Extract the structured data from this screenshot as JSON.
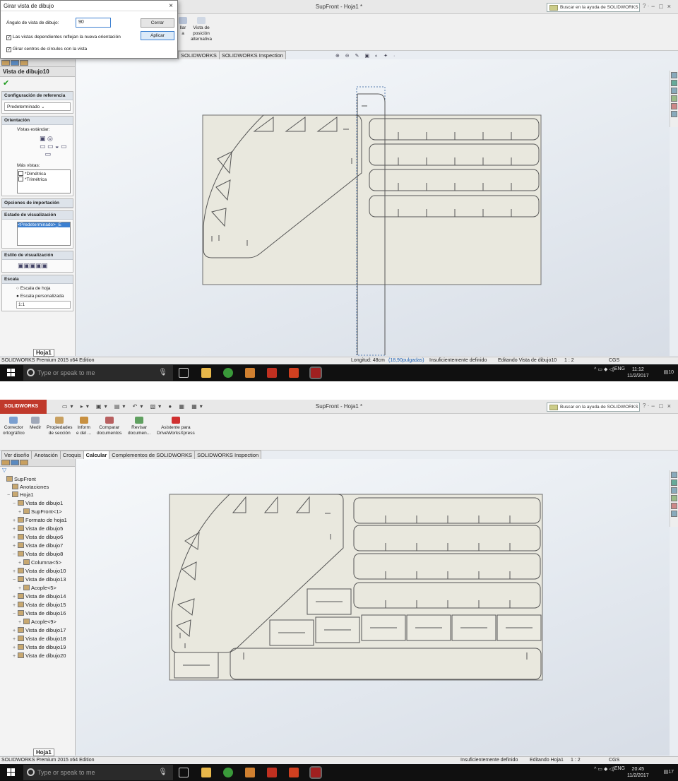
{
  "shot1": {
    "window_title": "SupFront - Hoja1 *",
    "search_placeholder": "Buscar en la ayuda de SOLIDWORKS",
    "ribbon_items": [
      "llar\na",
      "Vista de\nposición\nalternativa"
    ],
    "tabs": [
      "SOLIDWORKS",
      "SOLIDWORKS Inspection"
    ],
    "dialog": {
      "title": "Girar vista de dibujo",
      "angle_label": "Ángulo de vista de dibujo:",
      "angle_value": "90",
      "close_button": "Cerrar",
      "apply_button": "Aplicar",
      "check_dependent": "Las vistas dependientes reflejan la nueva orientación",
      "check_circles": "Girar centros de círculos con la vista"
    },
    "panel": {
      "title": "Vista de dibujo10",
      "config_header": "Configuración de referencia",
      "config_value": "Predeterminado",
      "orientation_header": "Orientación",
      "std_views_label": "Vistas estándar:",
      "more_views_label": "Más vistas:",
      "more_views": [
        "*Dimétrica",
        "*Trimétrica"
      ],
      "import_header": "Opciones de importación",
      "display_state_header": "Estado de visualización",
      "display_state_value": "<Predeterminado>_E",
      "display_style_header": "Estilo de visualización",
      "scale_header": "Escala",
      "scale_sheet": "Escala de hoja",
      "scale_custom": "Escala personalizada",
      "scale_value": "1:1"
    },
    "sheet_tab": "Hoja1",
    "status": {
      "edition": "SOLIDWORKS Premium 2015 x64 Edition",
      "length": "Longitud: 48cm",
      "length_in": "(18,90pulgadas)",
      "definition": "Insuficientemente definido",
      "editing": "Editando Vista de dibujo10",
      "scale": "1 : 2",
      "units": "CGS"
    },
    "taskbar": {
      "search": "Type or speak to me",
      "lang": "ENG",
      "time": "11:12",
      "date": "11/2/2017",
      "notif": "10"
    }
  },
  "shot2": {
    "window_title": "SupFront - Hoja1 *",
    "search_placeholder": "Buscar en la ayuda de SOLIDWORKS",
    "logo": "SOLIDWORKS",
    "ribbon_items": [
      "Corrector\nortográfico",
      "Medir",
      "Propiedades\nde sección",
      "Inform\ne del ...",
      "Comparar\ndocumentos",
      "Revisar\ndocumen...",
      "Asistente para\nDriveWorksXpress"
    ],
    "tabs": [
      "Ver diseño",
      "Anotación",
      "Croquis",
      "Calcular",
      "Complementos de SOLIDWORKS",
      "SOLIDWORKS Inspection"
    ],
    "active_tab": 3,
    "tree": [
      {
        "label": "SupFront",
        "level": 0,
        "pm": ""
      },
      {
        "label": "Anotaciones",
        "level": 1,
        "pm": ""
      },
      {
        "label": "Hoja1",
        "level": 1,
        "pm": "−"
      },
      {
        "label": "Vista de dibujo1",
        "level": 2,
        "pm": "−"
      },
      {
        "label": "SupFront<1>",
        "level": 3,
        "pm": "+"
      },
      {
        "label": "Formato de hoja1",
        "level": 2,
        "pm": "+"
      },
      {
        "label": "Vista de dibujo5",
        "level": 2,
        "pm": "+"
      },
      {
        "label": "Vista de dibujo6",
        "level": 2,
        "pm": "+"
      },
      {
        "label": "Vista de dibujo7",
        "level": 2,
        "pm": "+"
      },
      {
        "label": "Vista de dibujo8",
        "level": 2,
        "pm": "−"
      },
      {
        "label": "Columna<5>",
        "level": 3,
        "pm": "+"
      },
      {
        "label": "Vista de dibujo10",
        "level": 2,
        "pm": "+"
      },
      {
        "label": "Vista de dibujo13",
        "level": 2,
        "pm": "−"
      },
      {
        "label": "Acople<5>",
        "level": 3,
        "pm": "+"
      },
      {
        "label": "Vista de dibujo14",
        "level": 2,
        "pm": "+"
      },
      {
        "label": "Vista de dibujo15",
        "level": 2,
        "pm": "+"
      },
      {
        "label": "Vista de dibujo16",
        "level": 2,
        "pm": "−"
      },
      {
        "label": "Acople<9>",
        "level": 3,
        "pm": "+"
      },
      {
        "label": "Vista de dibujo17",
        "level": 2,
        "pm": "+"
      },
      {
        "label": "Vista de dibujo18",
        "level": 2,
        "pm": "+"
      },
      {
        "label": "Vista de dibujo19",
        "level": 2,
        "pm": "+"
      },
      {
        "label": "Vista de dibujo20",
        "level": 2,
        "pm": "+"
      }
    ],
    "sheet_tab": "Hoja1",
    "status": {
      "edition": "SOLIDWORKS Premium 2015 x64 Edition",
      "definition": "Insuficientemente definido",
      "editing": "Editando Hoja1",
      "scale": "1 : 2",
      "units": "CGS"
    },
    "taskbar": {
      "search": "Type or speak to me",
      "lang": "ENG",
      "time": "20:45",
      "date": "11/2/2017",
      "notif": "17"
    }
  },
  "colors": {
    "sheet": "#e9e8de",
    "outline": "#555555",
    "taskbar": "#101010",
    "accent": "#3b7fd0",
    "tab_bg": "#e4e4e4"
  }
}
